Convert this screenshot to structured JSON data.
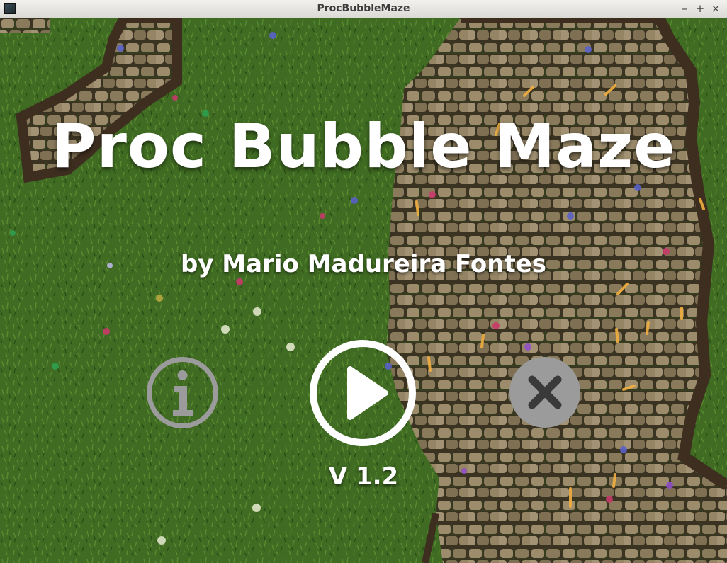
{
  "window": {
    "title": "ProcBubbleMaze",
    "controls": {
      "minimize": "–",
      "maximize": "+",
      "close": "×"
    }
  },
  "menu": {
    "game_title": "Proc Bubble Maze",
    "author": "by Mario Madureira Fontes",
    "version": "V 1.2",
    "buttons": [
      {
        "id": "info",
        "icon": "info-icon",
        "state": "dimmed"
      },
      {
        "id": "play",
        "icon": "play-icon",
        "state": "active"
      },
      {
        "id": "quit",
        "icon": "close-icon",
        "state": "dimmed"
      }
    ]
  },
  "colors": {
    "grass": "#3f6b22",
    "stone": "#8a7a5c",
    "wall": "#4a3826",
    "text": "#ffffff",
    "button_dimmed": "#9b9b9b",
    "button_active": "#ffffff"
  }
}
